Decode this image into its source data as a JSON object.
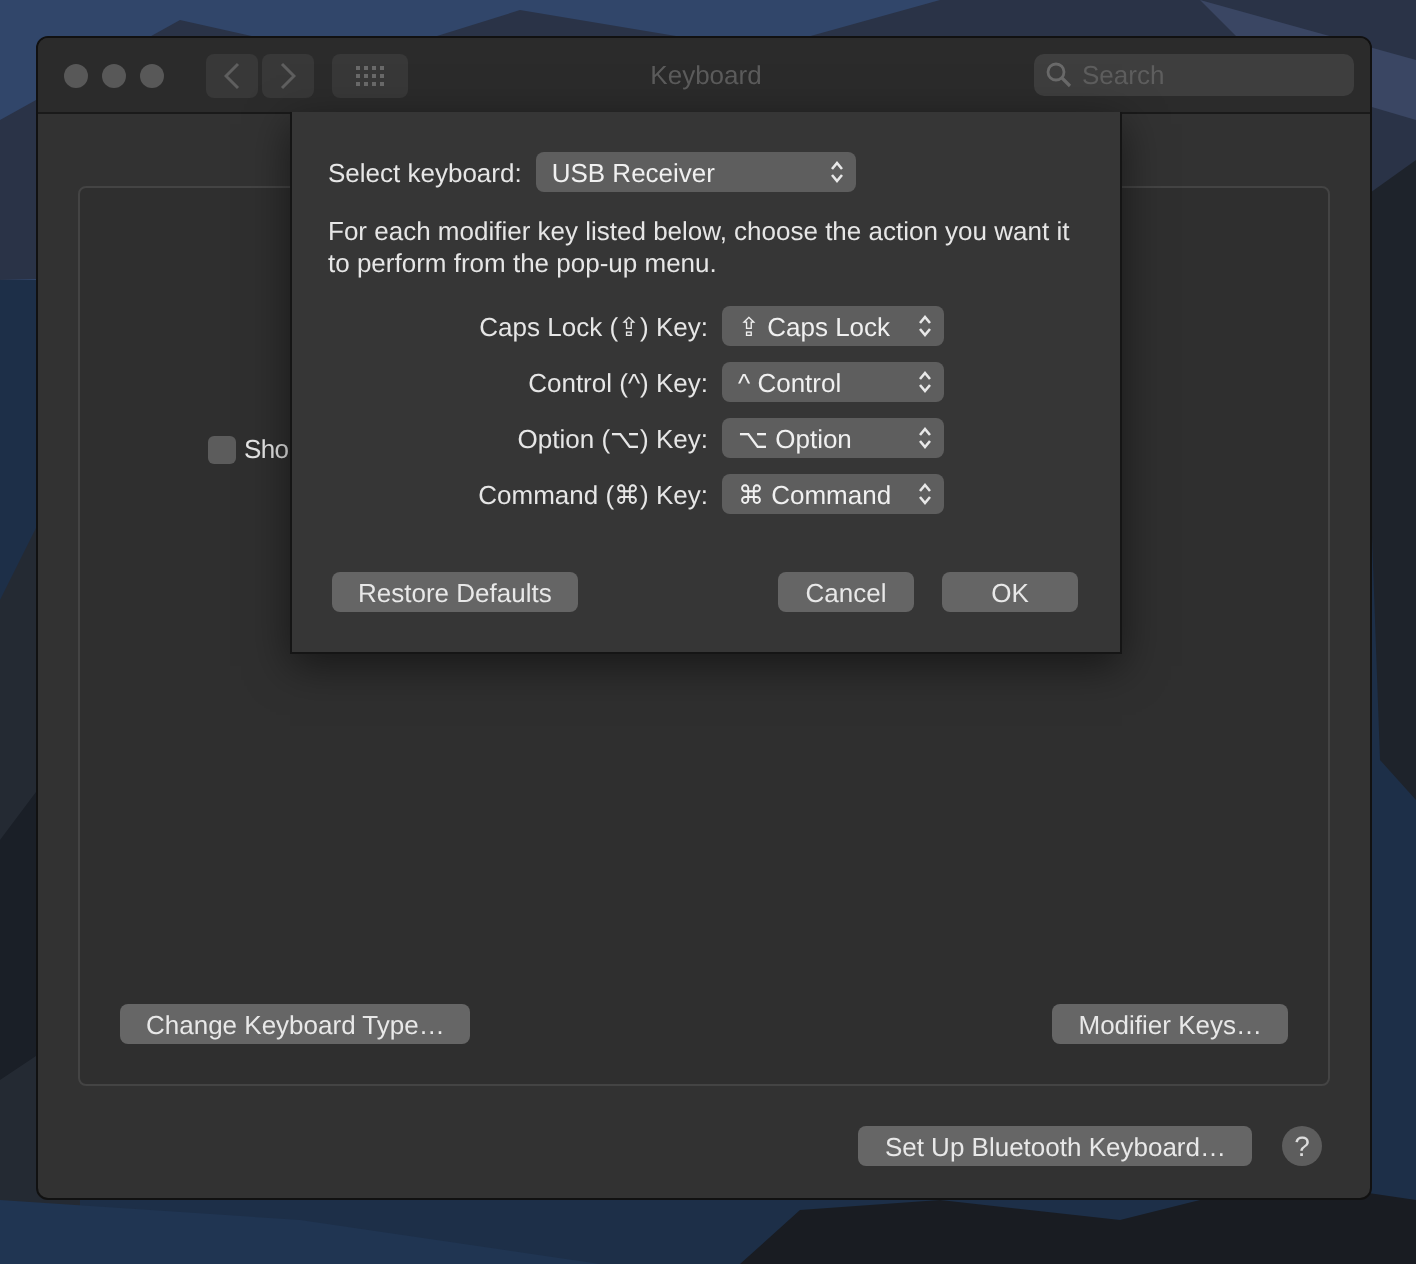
{
  "window": {
    "title": "Keyboard"
  },
  "search": {
    "placeholder": "Search"
  },
  "main": {
    "checkbox": {
      "label": "Sho",
      "checked": false
    },
    "buttons": [
      "Change Keyboard Type…",
      "Modifier Keys…"
    ]
  },
  "footer": {
    "button": "Set Up Bluetooth Keyboard…",
    "help": "?"
  },
  "sheet": {
    "select_label": "Select keyboard:",
    "select_value": "USB Receiver",
    "instructions": "For each modifier key listed below, choose the action you want it to perform from the pop-up menu.",
    "modifiers": [
      {
        "label": "Caps Lock (⇪) Key:",
        "value": "⇪ Caps Lock"
      },
      {
        "label": "Control (^) Key:",
        "value": "^ Control"
      },
      {
        "label": "Option (⌥) Key:",
        "value": "⌥ Option"
      },
      {
        "label": "Command (⌘) Key:",
        "value": "⌘ Command"
      }
    ],
    "restore_button": "Restore Defaults",
    "cancel_button": "Cancel",
    "ok_button": "OK"
  }
}
